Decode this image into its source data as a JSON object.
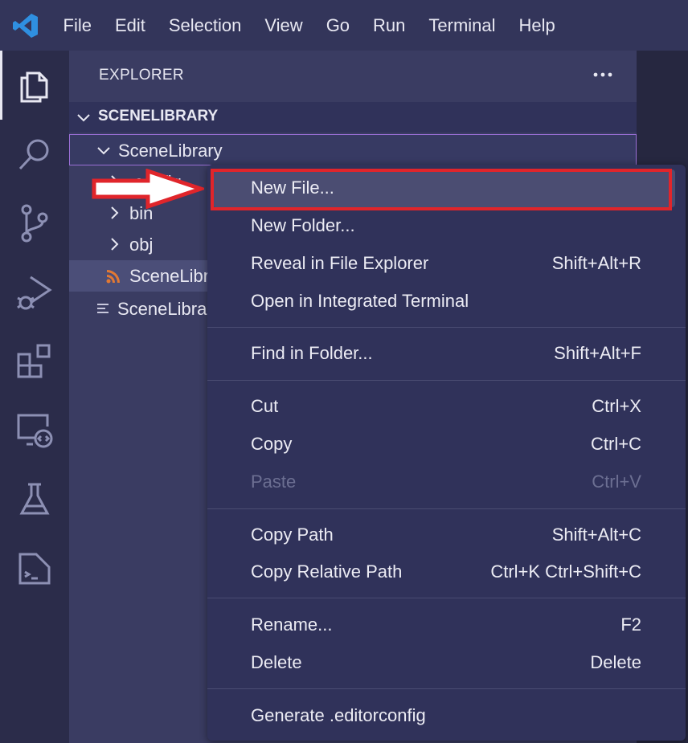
{
  "menubar": {
    "items": [
      "File",
      "Edit",
      "Selection",
      "View",
      "Go",
      "Run",
      "Terminal",
      "Help"
    ]
  },
  "activitybar": {
    "icons": [
      "explorer-icon",
      "search-icon",
      "source-control-icon",
      "run-debug-icon",
      "extensions-icon",
      "remote-explorer-icon",
      "testing-icon",
      "terminal-icon"
    ]
  },
  "sidebar": {
    "title": "EXPLORER",
    "section_title": "SCENELIBRARY",
    "tree": [
      {
        "label": "SceneLibrary",
        "kind": "folder-open"
      },
      {
        "label": ".config",
        "kind": "folder"
      },
      {
        "label": "bin",
        "kind": "folder"
      },
      {
        "label": "obj",
        "kind": "folder"
      },
      {
        "label": "SceneLibr",
        "kind": "rss-file"
      },
      {
        "label": "SceneLibra",
        "kind": "text-file"
      }
    ]
  },
  "context_menu": {
    "items": [
      {
        "label": "New File...",
        "shortcut": ""
      },
      {
        "label": "New Folder...",
        "shortcut": ""
      },
      {
        "label": "Reveal in File Explorer",
        "shortcut": "Shift+Alt+R"
      },
      {
        "label": "Open in Integrated Terminal",
        "shortcut": ""
      },
      {
        "label": "Find in Folder...",
        "shortcut": "Shift+Alt+F"
      },
      {
        "label": "Cut",
        "shortcut": "Ctrl+X"
      },
      {
        "label": "Copy",
        "shortcut": "Ctrl+C"
      },
      {
        "label": "Paste",
        "shortcut": "Ctrl+V"
      },
      {
        "label": "Copy Path",
        "shortcut": "Shift+Alt+C"
      },
      {
        "label": "Copy Relative Path",
        "shortcut": "Ctrl+K Ctrl+Shift+C"
      },
      {
        "label": "Rename...",
        "shortcut": "F2"
      },
      {
        "label": "Delete",
        "shortcut": "Delete"
      },
      {
        "label": "Generate .editorconfig",
        "shortcut": ""
      }
    ]
  },
  "colors": {
    "annotation_red": "#e0252b",
    "vscode_blue": "#2f8fe0",
    "rss_orange": "#e37933"
  }
}
